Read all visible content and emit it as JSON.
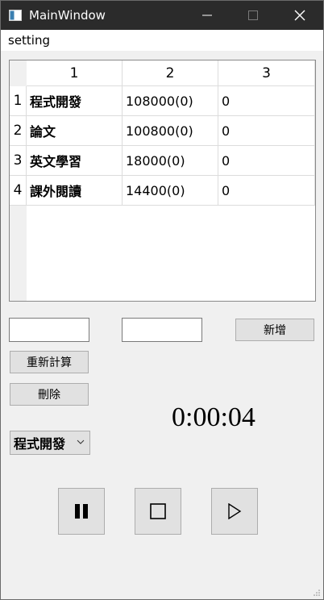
{
  "window": {
    "title": "MainWindow"
  },
  "menu": {
    "setting": "setting"
  },
  "table": {
    "headers": [
      "1",
      "2",
      "3"
    ],
    "rows": [
      {
        "num": "1",
        "c1": "程式開發",
        "c2": "108000(0)",
        "c3": "0"
      },
      {
        "num": "2",
        "c1": "論文",
        "c2": "100800(0)",
        "c3": "0"
      },
      {
        "num": "3",
        "c1": "英文學習",
        "c2": "18000(0)",
        "c3": "0"
      },
      {
        "num": "4",
        "c1": "課外閱讀",
        "c2": "14400(0)",
        "c3": "0"
      }
    ]
  },
  "form": {
    "input1_value": "",
    "input2_value": "",
    "add_label": "新增",
    "recalc_label": "重新計算",
    "delete_label": "刪除",
    "combo_selected": "程式開發"
  },
  "timer": {
    "display": "0:00:04"
  },
  "media": {
    "pause_icon": "pause-icon",
    "stop_icon": "stop-icon",
    "play_icon": "play-icon"
  },
  "colors": {
    "titlebar": "#2b2b2b",
    "window_bg": "#f0f0f0",
    "button_bg": "#e1e1e1"
  }
}
